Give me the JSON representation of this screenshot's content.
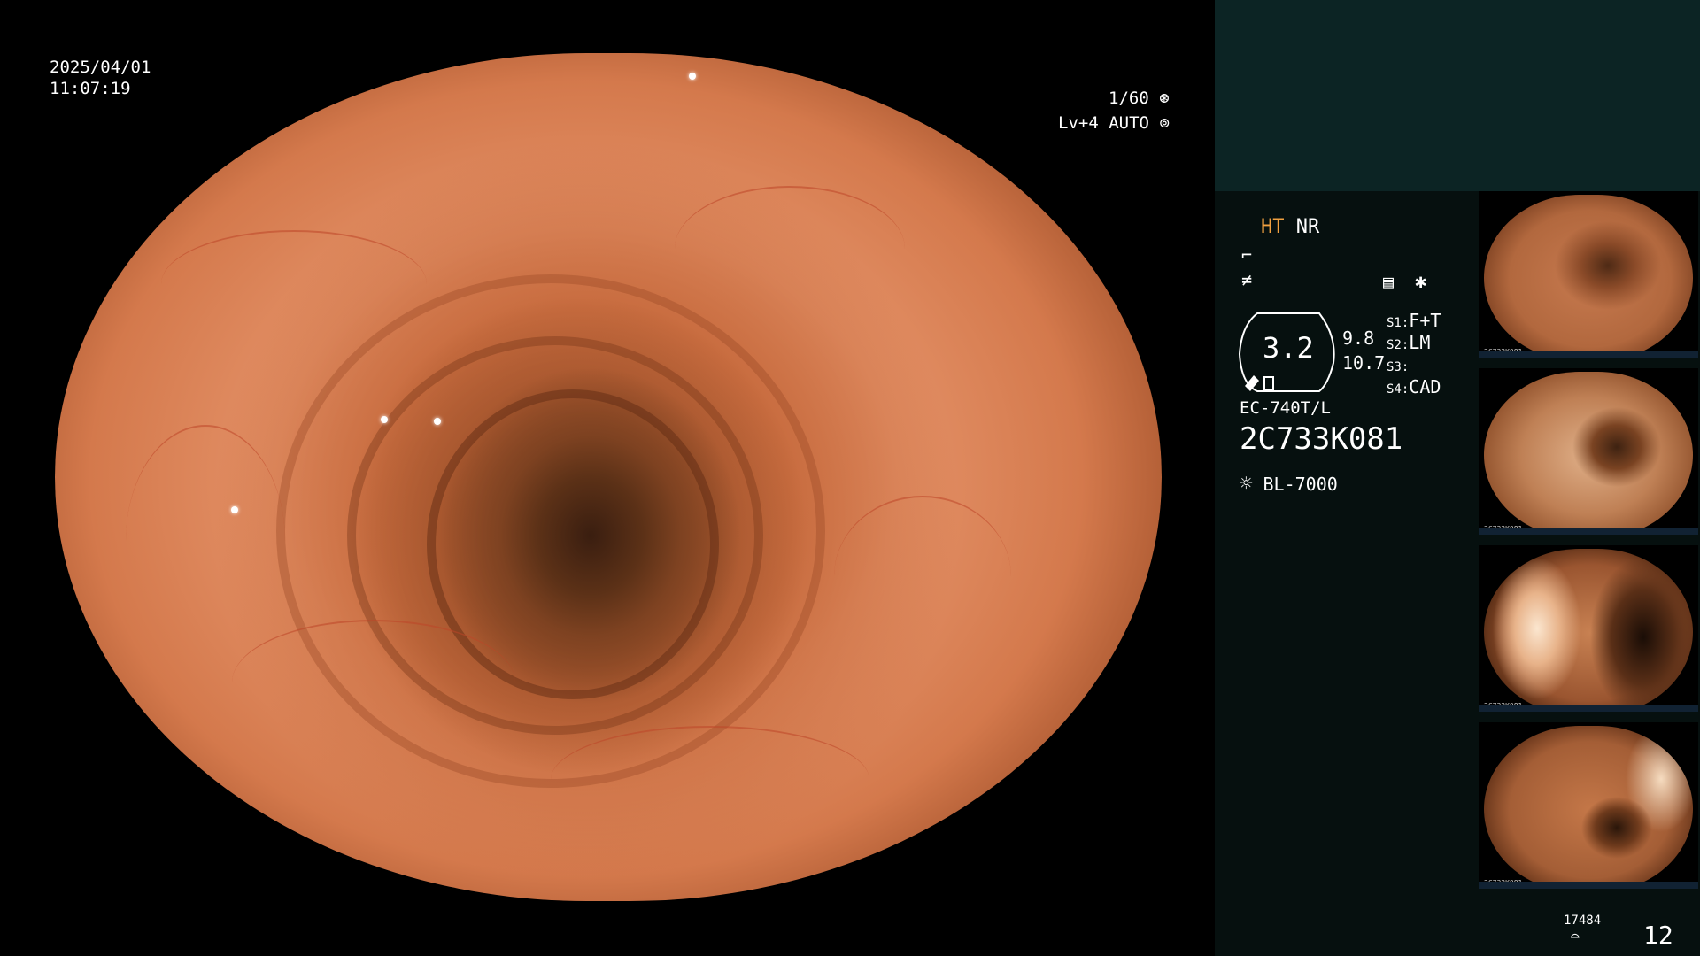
{
  "overlay": {
    "date": "2025/04/01",
    "time": "11:07:19",
    "shutter": "1/60",
    "level": "Lv+4",
    "mode": "AUTO"
  },
  "panel": {
    "ht_label": "HT",
    "nr_label": "NR",
    "dial_value": "3.2",
    "value_1": "9.8",
    "value_2": "10.7",
    "switches": [
      {
        "key": "S1:",
        "value": "F+T"
      },
      {
        "key": "S2:",
        "value": "LM"
      },
      {
        "key": "S3:",
        "value": ""
      },
      {
        "key": "S4:",
        "value": "CAD"
      }
    ],
    "scope_model": "EC-740T/L",
    "scope_serial": "2C733K081",
    "light_source": "BL-7000",
    "storage_count": "17484",
    "frame_count": "12",
    "colors": {
      "ht": "#f0a040",
      "panel_bg": "#06100f",
      "panel_top": "#0c2424"
    }
  },
  "thumbnails": [
    {
      "caption": "2C733K081"
    },
    {
      "caption": "2C733K081"
    },
    {
      "caption": "2C733K081"
    },
    {
      "caption": "2C733K081"
    }
  ]
}
